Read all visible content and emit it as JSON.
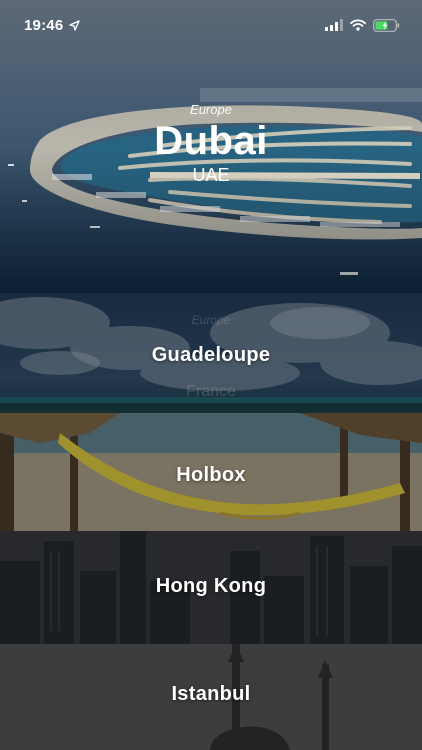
{
  "status_bar": {
    "time": "19:46",
    "icons": [
      "location-arrow-icon",
      "signal-bars-icon",
      "wifi-icon",
      "battery-charging-icon"
    ]
  },
  "featured": {
    "continent": "Europe",
    "city": "Dubai",
    "country": "UAE"
  },
  "destinations": [
    {
      "city": "Guadeloupe",
      "continent": "Europe",
      "country": "France"
    },
    {
      "city": "Holbox"
    },
    {
      "city": "Hong Kong"
    },
    {
      "city": "Istanbul"
    }
  ],
  "colors": {
    "battery": "#4cd964",
    "hero_sea": "#173a5a"
  }
}
